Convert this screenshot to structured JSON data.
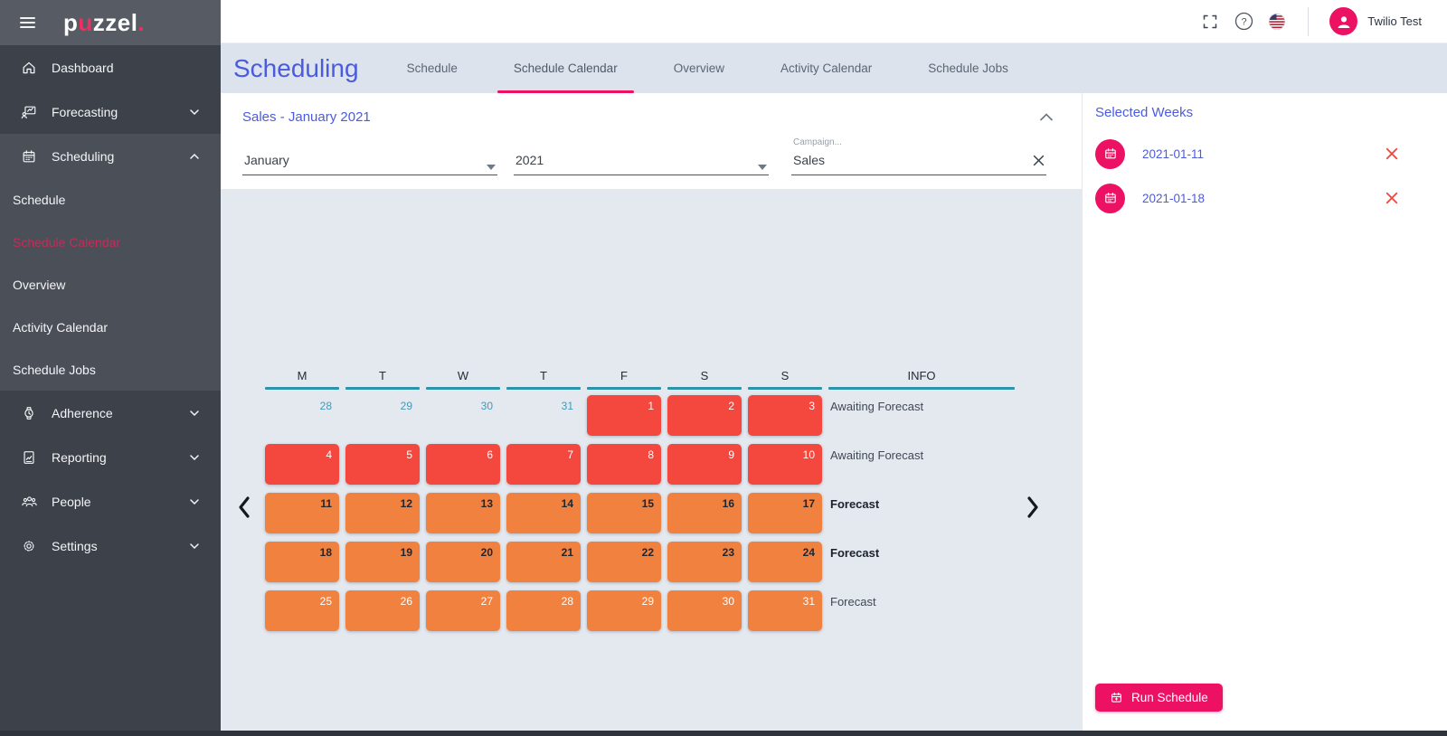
{
  "colors": {
    "accent_pink": "#ed1164",
    "blue": "#4a5be0",
    "red": "#f4473d",
    "orange": "#f0813f",
    "teal": "#2d93ab",
    "active_subitem": "#c42c58"
  },
  "sidebar": {
    "logo": {
      "left": "p",
      "accent": "u",
      "right": "zzel",
      "dot": "."
    },
    "items": [
      {
        "label": "Dashboard"
      },
      {
        "label": "Forecasting"
      },
      {
        "label": "Scheduling",
        "expanded": true,
        "active_child": "Schedule Calendar",
        "children": [
          "Schedule",
          "Schedule Calendar",
          "Overview",
          "Activity Calendar",
          "Schedule Jobs"
        ]
      },
      {
        "label": "Adherence"
      },
      {
        "label": "Reporting"
      },
      {
        "label": "People"
      },
      {
        "label": "Settings"
      }
    ]
  },
  "topbar": {
    "user_name": "Twilio Test"
  },
  "page": {
    "title": "Scheduling",
    "tabs": [
      "Schedule",
      "Schedule Calendar",
      "Overview",
      "Activity Calendar",
      "Schedule Jobs"
    ],
    "active_tab": "Schedule Calendar"
  },
  "filter": {
    "title": "Sales - January 2021",
    "month": "January",
    "year": "2021",
    "campaign_label": "Campaign...",
    "campaign_value": "Sales"
  },
  "calendar": {
    "headers": [
      "M",
      "T",
      "W",
      "T",
      "F",
      "S",
      "S",
      "INFO"
    ],
    "weeks": [
      {
        "info": "Awaiting Forecast",
        "bold": false,
        "days": [
          {
            "n": 28,
            "style": "plain"
          },
          {
            "n": 29,
            "style": "plain"
          },
          {
            "n": 30,
            "style": "plain"
          },
          {
            "n": 31,
            "style": "plain"
          },
          {
            "n": 1,
            "style": "red"
          },
          {
            "n": 2,
            "style": "red"
          },
          {
            "n": 3,
            "style": "red"
          }
        ]
      },
      {
        "info": "Awaiting Forecast",
        "bold": false,
        "days": [
          {
            "n": 4,
            "style": "red"
          },
          {
            "n": 5,
            "style": "red"
          },
          {
            "n": 6,
            "style": "red"
          },
          {
            "n": 7,
            "style": "red"
          },
          {
            "n": 8,
            "style": "red"
          },
          {
            "n": 9,
            "style": "red"
          },
          {
            "n": 10,
            "style": "red"
          }
        ]
      },
      {
        "info": "Forecast",
        "bold": true,
        "days": [
          {
            "n": 11,
            "style": "sel"
          },
          {
            "n": 12,
            "style": "sel"
          },
          {
            "n": 13,
            "style": "sel"
          },
          {
            "n": 14,
            "style": "sel"
          },
          {
            "n": 15,
            "style": "sel"
          },
          {
            "n": 16,
            "style": "sel"
          },
          {
            "n": 17,
            "style": "sel"
          }
        ]
      },
      {
        "info": "Forecast",
        "bold": true,
        "days": [
          {
            "n": 18,
            "style": "sel"
          },
          {
            "n": 19,
            "style": "sel"
          },
          {
            "n": 20,
            "style": "sel"
          },
          {
            "n": 21,
            "style": "sel"
          },
          {
            "n": 22,
            "style": "sel"
          },
          {
            "n": 23,
            "style": "sel"
          },
          {
            "n": 24,
            "style": "sel"
          }
        ]
      },
      {
        "info": "Forecast",
        "bold": false,
        "days": [
          {
            "n": 25,
            "style": "orange"
          },
          {
            "n": 26,
            "style": "orange"
          },
          {
            "n": 27,
            "style": "orange"
          },
          {
            "n": 28,
            "style": "orange"
          },
          {
            "n": 29,
            "style": "orange"
          },
          {
            "n": 30,
            "style": "orange"
          },
          {
            "n": 31,
            "style": "orange"
          }
        ]
      }
    ]
  },
  "selected_weeks": {
    "title": "Selected Weeks",
    "items": [
      {
        "date": "2021-01-11"
      },
      {
        "date": "2021-01-18"
      }
    ],
    "run_button_label": "Run Schedule"
  }
}
